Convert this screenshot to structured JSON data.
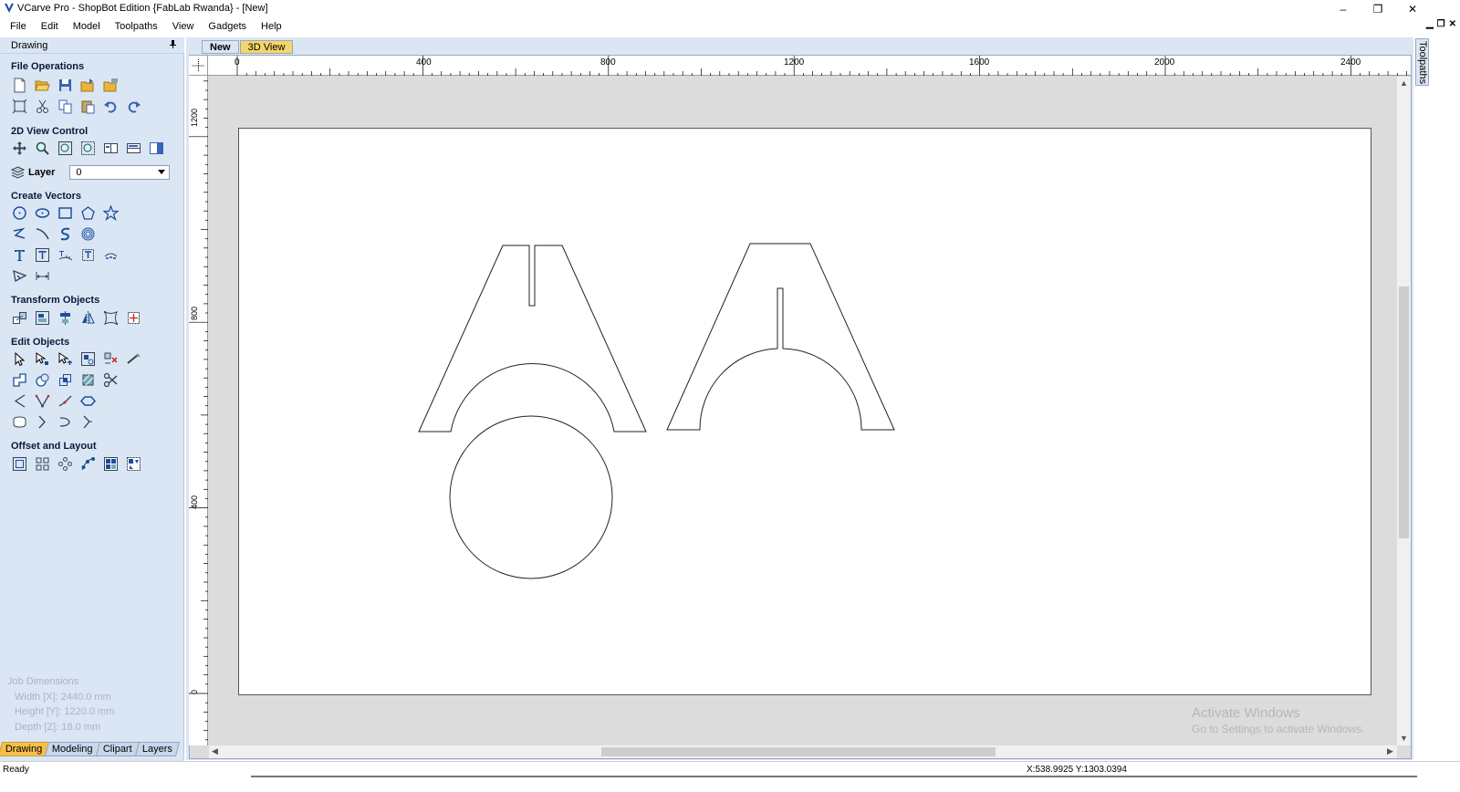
{
  "window": {
    "title": "VCarve Pro - ShopBot Edition {FabLab Rwanda} - [New]",
    "controls": {
      "minimize": "–",
      "maximize": "❐",
      "close": "✕"
    },
    "mdi_controls": {
      "minimize": "▁",
      "restore": "❐",
      "close": "✕"
    }
  },
  "menu": [
    "File",
    "Edit",
    "Model",
    "Toolpaths",
    "View",
    "Gadgets",
    "Help"
  ],
  "left_panel": {
    "title": "Drawing",
    "pin_icon": "pin-icon",
    "sections": {
      "file_operations": "File Operations",
      "view_control": "2D View Control",
      "create_vectors": "Create Vectors",
      "transform_objects": "Transform Objects",
      "edit_objects": "Edit Objects",
      "offset_layout": "Offset and Layout"
    },
    "layer": {
      "label": "Layer",
      "value": "0"
    },
    "job_dimensions": {
      "title": "Job Dimensions",
      "width": "Width  [X]: 2440.0 mm",
      "height": "Height [Y]: 1220.0 mm",
      "depth": "Depth  [Z]: 18.0 mm"
    },
    "bottom_tabs": [
      {
        "label": "Drawing",
        "active": true
      },
      {
        "label": "Modeling",
        "active": false
      },
      {
        "label": "Clipart",
        "active": false
      },
      {
        "label": "Layers",
        "active": false
      }
    ]
  },
  "doc_tabs": [
    {
      "label": "New",
      "active": true
    },
    {
      "label": "3D View",
      "active": false
    }
  ],
  "rulers": {
    "horizontal": [
      "0",
      "400",
      "800",
      "1200",
      "1600",
      "2000",
      "2400"
    ],
    "vertical": [
      "1200",
      "800",
      "400",
      "0"
    ]
  },
  "right_tab": "Toolpaths",
  "watermark": {
    "line1": "Activate Windows",
    "line2": "Go to Settings to activate Windows."
  },
  "status": {
    "text": "Ready",
    "coords": "X:538.9925 Y:1303.0394"
  }
}
